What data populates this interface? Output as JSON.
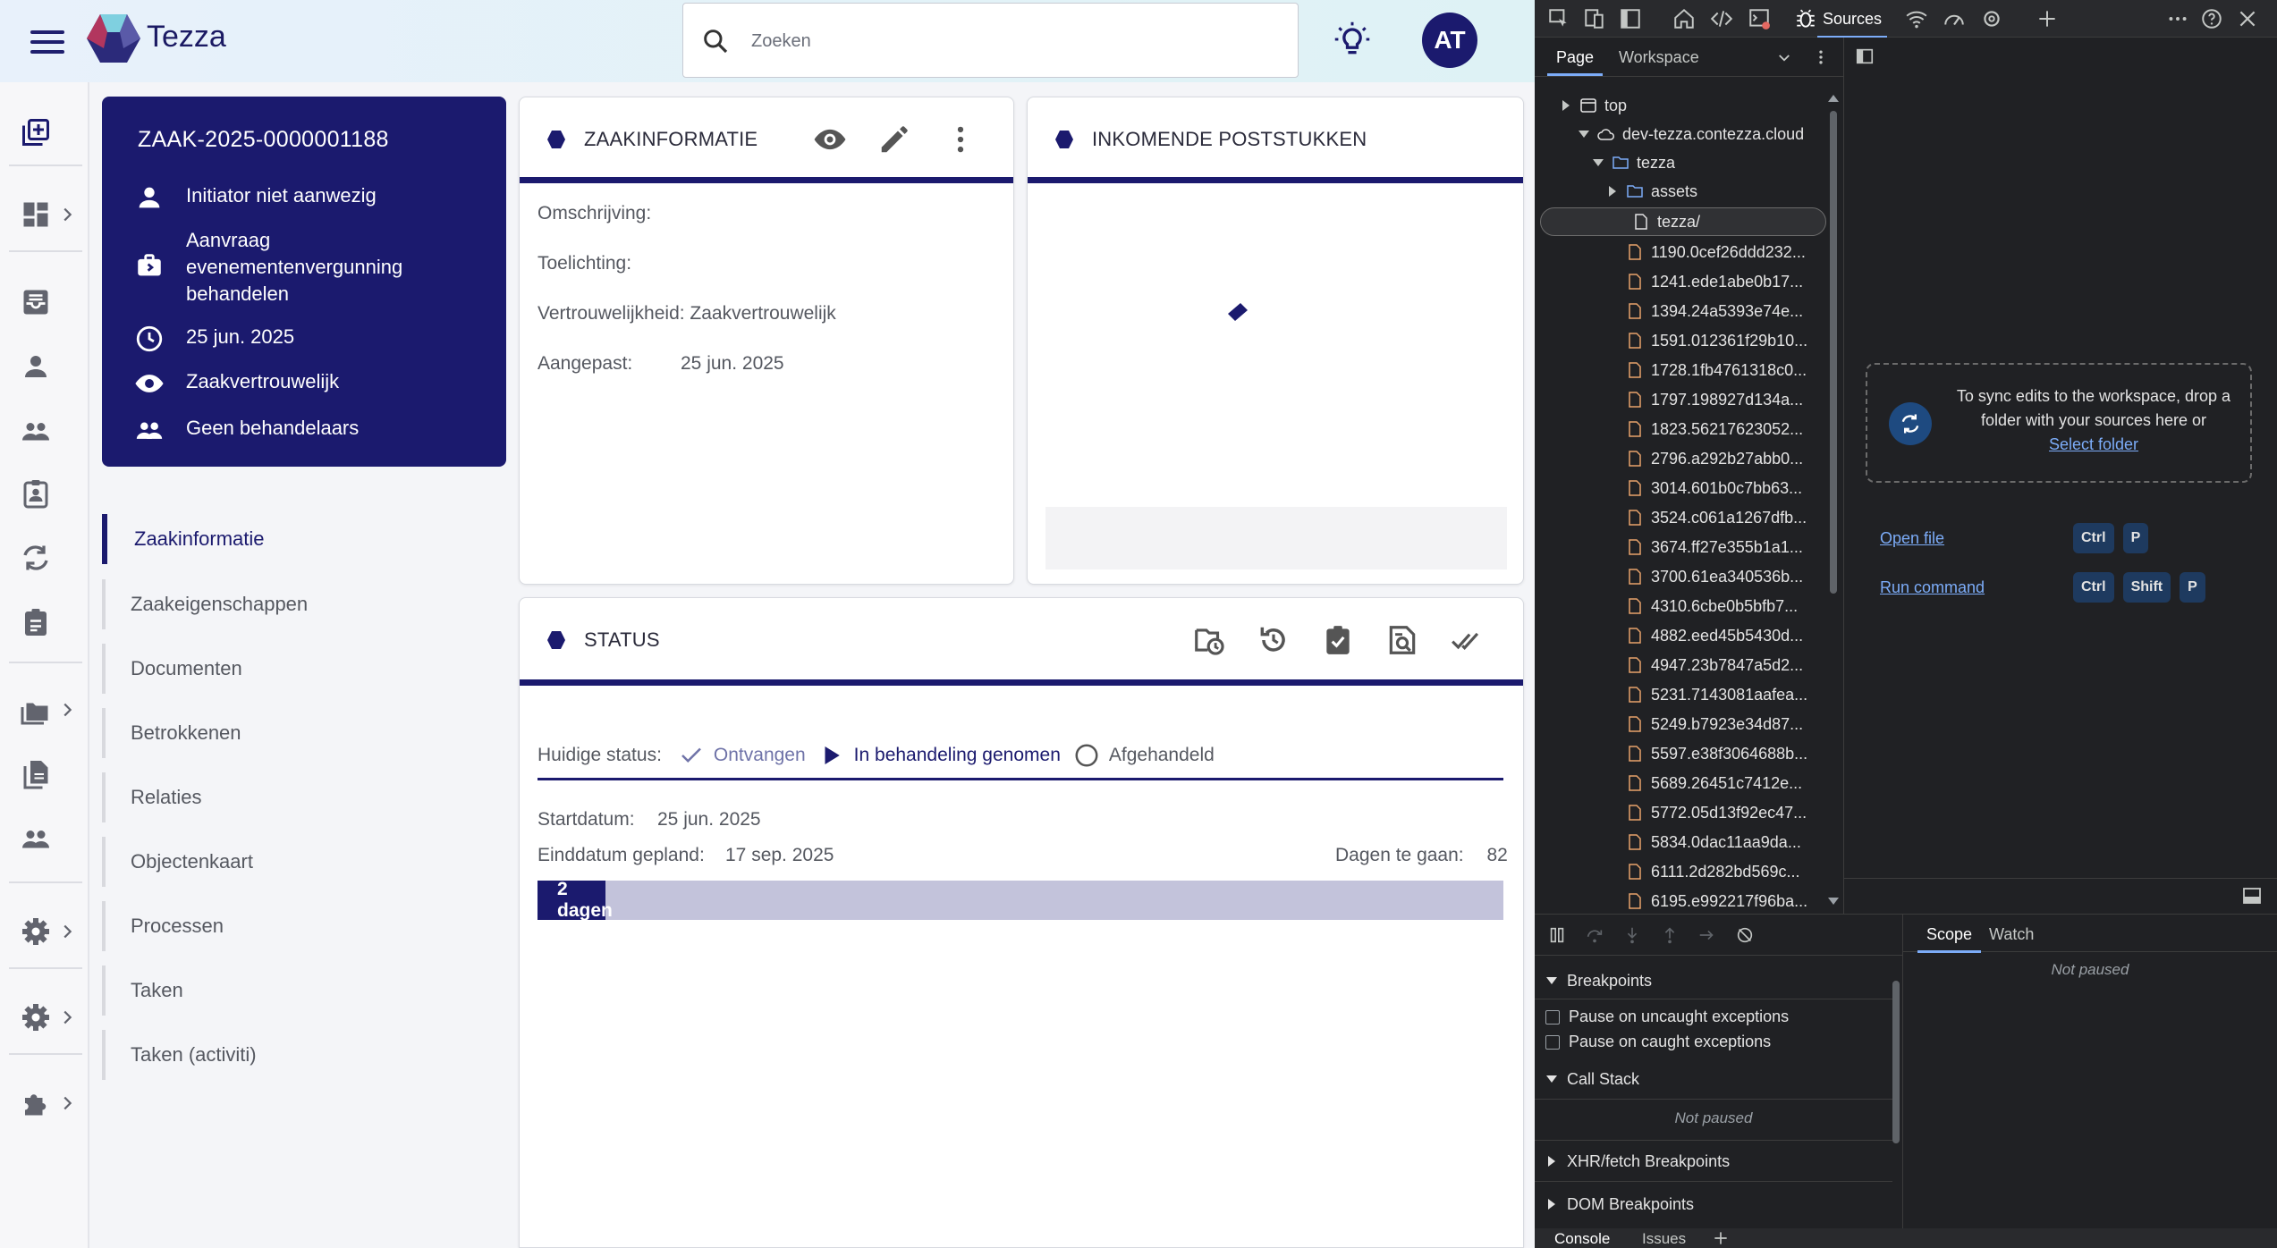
{
  "app": {
    "name": "Tezza",
    "search_placeholder": "Zoeken",
    "user_initials": "AT"
  },
  "case": {
    "id": "ZAAK-2025-0000001188",
    "initiator": "Initiator niet aanwezig",
    "type": "Aanvraag evenementenvergunning behandelen",
    "date": "25 jun. 2025",
    "confidentiality": "Zaakvertrouwelijk",
    "handlers": "Geen behandelaars"
  },
  "nav": {
    "items": [
      "Zaakinformatie",
      "Zaakeigenschappen",
      "Documenten",
      "Betrokkenen",
      "Relaties",
      "Objectenkaart",
      "Processen",
      "Taken",
      "Taken (activiti)"
    ]
  },
  "zaakinfo": {
    "title": "ZAAKINFORMATIE",
    "omschrijving_label": "Omschrijving:",
    "toelichting_label": "Toelichting:",
    "vertrouwelijkheid": "Vertrouwelijkheid: Zaakvertrouwelijk",
    "aangepast_label": "Aangepast:",
    "aangepast_value": "25 jun. 2025"
  },
  "poststukken": {
    "title": "INKOMENDE POSTSTUKKEN"
  },
  "status": {
    "title": "STATUS",
    "current_label": "Huidige status:",
    "steps": [
      "Ontvangen",
      "In behandeling genomen",
      "Afgehandeld"
    ],
    "start_label": "Startdatum:",
    "start_value": "25 jun. 2025",
    "end_label": "Einddatum gepland:",
    "end_value": "17 sep. 2025",
    "days_left_label": "Dagen te gaan:",
    "days_left_value": "82",
    "progress_label": "2 dagen",
    "progress_fraction": 0.07
  },
  "devtools": {
    "active_tab": "Sources",
    "nav_tabs": [
      "Page",
      "Workspace"
    ],
    "tree": {
      "top": "top",
      "domain": "dev-tezza.contezza.cloud",
      "folder1": "tezza",
      "folder2": "assets",
      "selected": "tezza/",
      "files": [
        "1190.0cef26ddd232...",
        "1241.ede1abe0b17...",
        "1394.24a5393e74e...",
        "1591.012361f29b10...",
        "1728.1fb4761318c0...",
        "1797.198927d134a...",
        "1823.56217623052...",
        "2796.a292b27abb0...",
        "3014.601b0c7bb63...",
        "3524.c061a1267dfb...",
        "3674.ff27e355b1a1...",
        "3700.61ea340536b...",
        "4310.6cbe0b5bfb7...",
        "4882.eed45b5430d...",
        "4947.23b7847a5d2...",
        "5231.7143081aafea...",
        "5249.b7923e34d87...",
        "5597.e38f3064688b...",
        "5689.26451c7412e...",
        "5772.05d13f92ec47...",
        "5834.0dac11aa9da...",
        "6111.2d282bd569c...",
        "6195.e992217f96ba..."
      ]
    },
    "drop_text": "To sync edits to the workspace, drop a folder with your sources here or",
    "select_folder": "Select folder",
    "open_file": "Open file",
    "run_command": "Run command",
    "kbd": {
      "ctrl": "Ctrl",
      "shift": "Shift",
      "p": "P"
    },
    "debugger": {
      "breakpoints": "Breakpoints",
      "pause_uncaught": "Pause on uncaught exceptions",
      "pause_caught": "Pause on caught exceptions",
      "call_stack": "Call Stack",
      "not_paused": "Not paused",
      "xhr": "XHR/fetch Breakpoints",
      "dom": "DOM Breakpoints",
      "scope": "Scope",
      "watch": "Watch"
    },
    "drawer": [
      "Console",
      "Issues"
    ]
  }
}
